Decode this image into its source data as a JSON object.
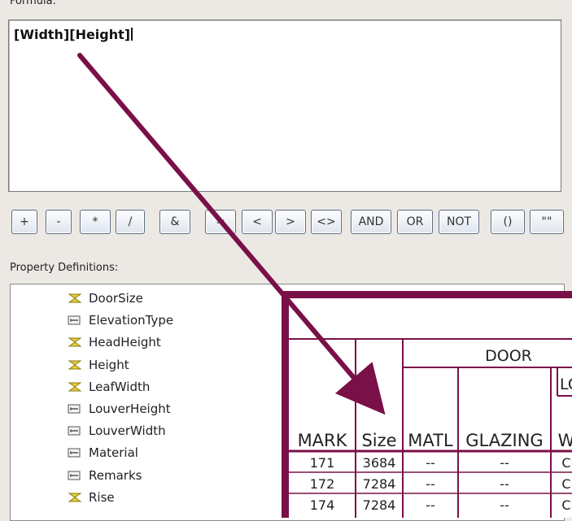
{
  "formula": {
    "label": "Formula:",
    "text": "[Width][Height]"
  },
  "operators": [
    {
      "label": "+"
    },
    {
      "label": "-"
    },
    {
      "label": "*"
    },
    {
      "label": "/"
    },
    {
      "label": "&"
    },
    {
      "label": "="
    },
    {
      "label": "<"
    },
    {
      "label": ">"
    },
    {
      "label": "<>"
    },
    {
      "label": "AND"
    },
    {
      "label": "OR"
    },
    {
      "label": "NOT"
    },
    {
      "label": "()"
    },
    {
      "label": "\"\""
    }
  ],
  "property_definitions": {
    "label": "Property Definitions:",
    "items": [
      {
        "label": "DoorSize",
        "icon": "automatic-property-icon"
      },
      {
        "label": "ElevationType",
        "icon": "manual-property-icon"
      },
      {
        "label": "HeadHeight",
        "icon": "automatic-property-icon"
      },
      {
        "label": "Height",
        "icon": "automatic-property-icon"
      },
      {
        "label": "LeafWidth",
        "icon": "automatic-property-icon"
      },
      {
        "label": "LouverHeight",
        "icon": "manual-property-icon"
      },
      {
        "label": "LouverWidth",
        "icon": "manual-property-icon"
      },
      {
        "label": "Material",
        "icon": "manual-property-icon"
      },
      {
        "label": "Remarks",
        "icon": "manual-property-icon"
      },
      {
        "label": "Rise",
        "icon": "automatic-property-icon"
      }
    ]
  },
  "schedule": {
    "group_header": "DOOR",
    "sub_header": "LO",
    "columns": [
      "MARK",
      "Size",
      "MATL",
      "GLAZING",
      "W"
    ],
    "rows": [
      {
        "mark": "171",
        "size": "3684",
        "matl": "--",
        "glazing": "--",
        "w": "C"
      },
      {
        "mark": "172",
        "size": "7284",
        "matl": "--",
        "glazing": "--",
        "w": "C"
      },
      {
        "mark": "174",
        "size": "7284",
        "matl": "--",
        "glazing": "--",
        "w": "C"
      }
    ]
  },
  "colors": {
    "accent": "#7a1048",
    "arrow": "#7a1048"
  }
}
